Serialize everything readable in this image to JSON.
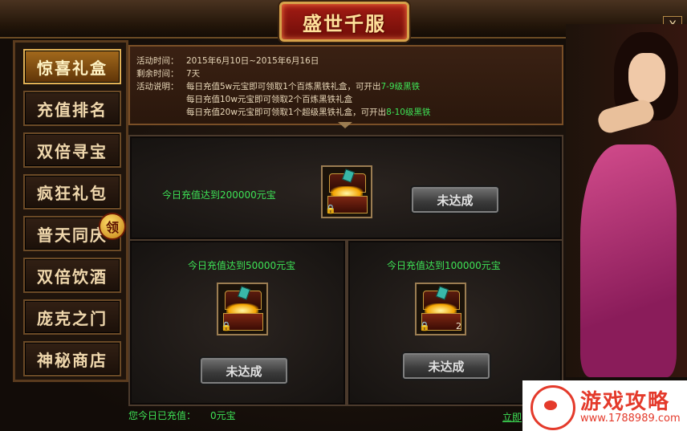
{
  "window": {
    "title": "盛世千服",
    "close_label": "X"
  },
  "sidebar": {
    "items": [
      {
        "label": "惊喜礼盒",
        "active": true
      },
      {
        "label": "充值排名"
      },
      {
        "label": "双倍寻宝"
      },
      {
        "label": "疯狂礼包"
      },
      {
        "label": "普天同庆",
        "badge": "领"
      },
      {
        "label": "双倍饮酒"
      },
      {
        "label": "庞克之门"
      },
      {
        "label": "神秘商店"
      }
    ]
  },
  "info": {
    "time_label": "活动时间：",
    "time_value": "2015年6月10日~2015年6月16日",
    "remain_label": "剩余时间：",
    "remain_value": "7天",
    "desc_label": "活动说明：",
    "desc_lines": [
      {
        "text": "每日充值5w元宝即可领取1个百炼黑铁礼盒，可开出",
        "highlight": "7-9级黑铁"
      },
      {
        "text": "每日充值10w元宝即可领取2个百炼黑铁礼盒",
        "highlight": ""
      },
      {
        "text": "每日充值20w元宝即可领取1个超级黑铁礼盒，可开出",
        "highlight": "8-10级黑铁"
      }
    ]
  },
  "rewards": [
    {
      "goal": "今日充值达到200000元宝",
      "button": "未达成",
      "qty": ""
    },
    {
      "goal": "今日充值达到50000元宝",
      "button": "未达成",
      "qty": ""
    },
    {
      "goal": "今日充值达到100000元宝",
      "button": "未达成",
      "qty": "2"
    }
  ],
  "footer": {
    "recharge_label": "您今日已充值：",
    "recharge_amount": "0元宝",
    "link": "立即"
  },
  "watermark": {
    "title": "游戏攻略",
    "url": "www.1788989.com"
  },
  "icons": [
    "close-icon",
    "chest-icon",
    "lock-icon",
    "badge-icon"
  ],
  "colors": {
    "highlight": "#3ee356",
    "gold": "#d6a24a",
    "title_red": "#a31c14"
  }
}
